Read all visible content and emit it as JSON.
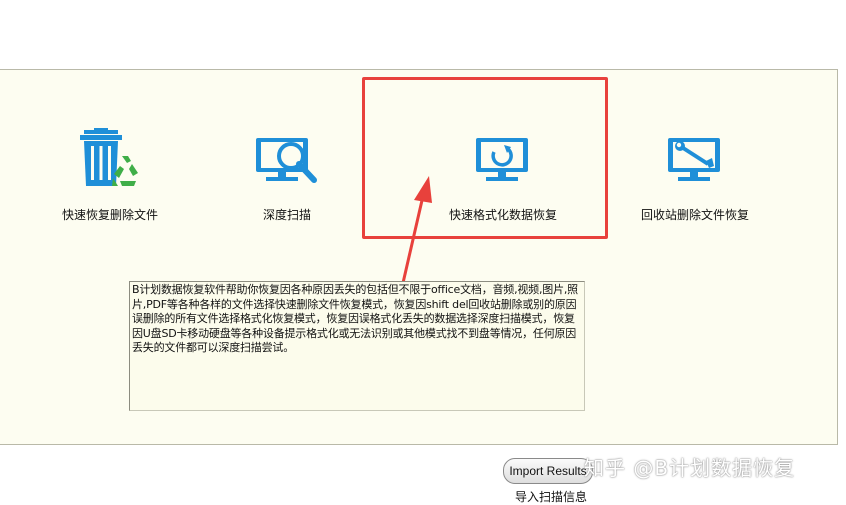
{
  "modes": [
    {
      "label": "快速恢复删除文件",
      "icon": "recycle-bin-icon"
    },
    {
      "label": "深度扫描",
      "icon": "monitor-magnifier-icon"
    },
    {
      "label": "快速格式化数据恢复",
      "icon": "monitor-refresh-icon"
    },
    {
      "label": "回收站删除文件恢复",
      "icon": "monitor-wrench-icon"
    }
  ],
  "description": "B计划数据恢复软件帮助你恢复因各种原因丢失的包括但不限于office文档，音频,视频,图片,照片,PDF等各种各样的文件选择快速删除文件恢复模式，恢复因shift del回收站删除或别的原因误删除的所有文件选择格式化恢复模式，恢复因误格式化丢失的数据选择深度扫描模式，恢复因U盘SD卡移动硬盘等各种设备提示格式化或无法识别或其他模式找不到盘等情况，任何原因丢失的文件都可以深度扫描尝试。",
  "import": {
    "button_label": "Import Results",
    "label": "导入扫描信息"
  },
  "watermark": "知乎 @B计划数据恢复",
  "colors": {
    "icon_blue": "#1f8fd8",
    "highlight_red": "#e8413c",
    "recycle_green": "#3fae48"
  }
}
